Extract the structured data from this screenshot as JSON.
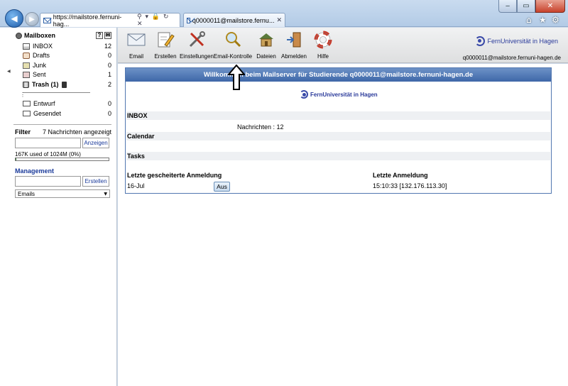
{
  "browser": {
    "address_host": "https://mailstore.fernuni-hag...",
    "address_tools": "⚲ ▾ 🔒 ↻ ✕",
    "tab_title": "q0000011@mailstore.fernu...",
    "tab_close": "✕",
    "window_buttons": [
      "‒",
      "▭",
      "✕"
    ],
    "right_icons": [
      "⌂",
      "★",
      "⚙"
    ]
  },
  "sidebar": {
    "root_label": "Mailboxen",
    "help_label": "?",
    "folders": [
      {
        "name": "INBOX",
        "count": "12",
        "icon": "inbox-icon"
      },
      {
        "name": "Drafts",
        "count": "0",
        "icon": "drafts-icon"
      },
      {
        "name": "Junk",
        "count": "0",
        "icon": "junk-icon"
      },
      {
        "name": "Sent",
        "count": "1",
        "icon": "sent-icon"
      },
      {
        "name": "Trash (1)",
        "count": "2",
        "icon": "trash-icon"
      }
    ],
    "extra_folders": [
      {
        "name": "Entwurf",
        "count": "0",
        "icon": "envelope-icon"
      },
      {
        "name": "Gesendet",
        "count": "0",
        "icon": "envelope-icon"
      }
    ],
    "filter": {
      "label": "Filter",
      "info": "7 Nachrichten angezeigt",
      "button": "Anzeigen",
      "input_value": ""
    },
    "quota": {
      "text": "167K used of 1024M  (0%)",
      "fraction": 0.01
    },
    "management": {
      "label": "Management",
      "button": "Erstellen",
      "input_value": "",
      "select_value": "Emails"
    }
  },
  "toolbar": {
    "items": [
      {
        "label": "Email",
        "icon": "envelope-icon"
      },
      {
        "label": "Erstellen",
        "icon": "compose-icon"
      },
      {
        "label": "Einstellungen",
        "icon": "tools-icon"
      },
      {
        "label": "Email-Kontrolle",
        "icon": "magnifier-icon"
      },
      {
        "label": "Dateien",
        "icon": "house-icon"
      },
      {
        "label": "Abmelden",
        "icon": "door-exit-icon"
      },
      {
        "label": "Hilfe",
        "icon": "lifebuoy-icon"
      }
    ],
    "brand": "FernUniversität in Hagen",
    "user_address": "q0000011@mailstore.fernuni-hagen.de"
  },
  "main": {
    "header": "Willkommen beim Mailserver für Studierende q0000011@mailstore.fernuni-hagen.de",
    "logo_text": "FernUniversität in Hagen",
    "inbox_label": "INBOX",
    "messages": "Nachrichten : 12",
    "calendar_label": "Calendar",
    "tasks_label": "Tasks",
    "failed_login_label": "Letzte gescheiterte Anmeldung",
    "failed_login_value": "16-Jul",
    "aus_button": "Aus",
    "last_login_label": "Letzte Anmeldung",
    "last_login_value": "15:10:33 [132.176.113.30]"
  },
  "colors": {
    "accent": "#3e67a8",
    "brand": "#2a3a9a",
    "link": "#1a3a9a"
  }
}
